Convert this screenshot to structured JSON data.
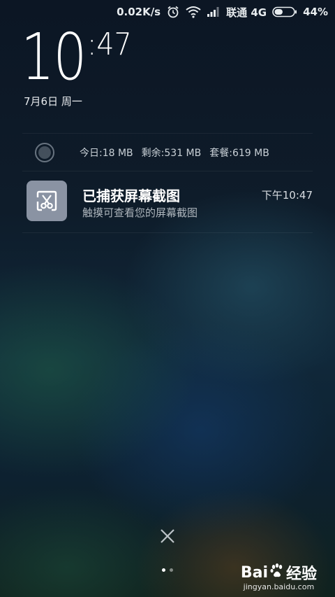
{
  "status_bar": {
    "speed": "0.02K/s",
    "carrier": "联通 4G",
    "battery": "44%",
    "battery_level": 0.44,
    "icons": [
      "alarm-icon",
      "wifi-icon",
      "signal-icon",
      "battery-icon"
    ]
  },
  "clock": {
    "hour": "10",
    "minute": ":47",
    "date": "7月6日 周一"
  },
  "data_usage": {
    "today": "今日:18 MB",
    "remaining": "剩余:531 MB",
    "plan": "套餐:619 MB"
  },
  "notification": {
    "title": "已捕获屏幕截图",
    "subtitle": "触摸可查看您的屏幕截图",
    "time": "下午10:47",
    "icon": "screenshot-scissors-icon"
  },
  "pager": {
    "pages": 2,
    "current": 1
  },
  "watermark": {
    "logo_text_left": "Bai",
    "logo_text_right": "经验",
    "url": "jingyan.baidu.com"
  }
}
